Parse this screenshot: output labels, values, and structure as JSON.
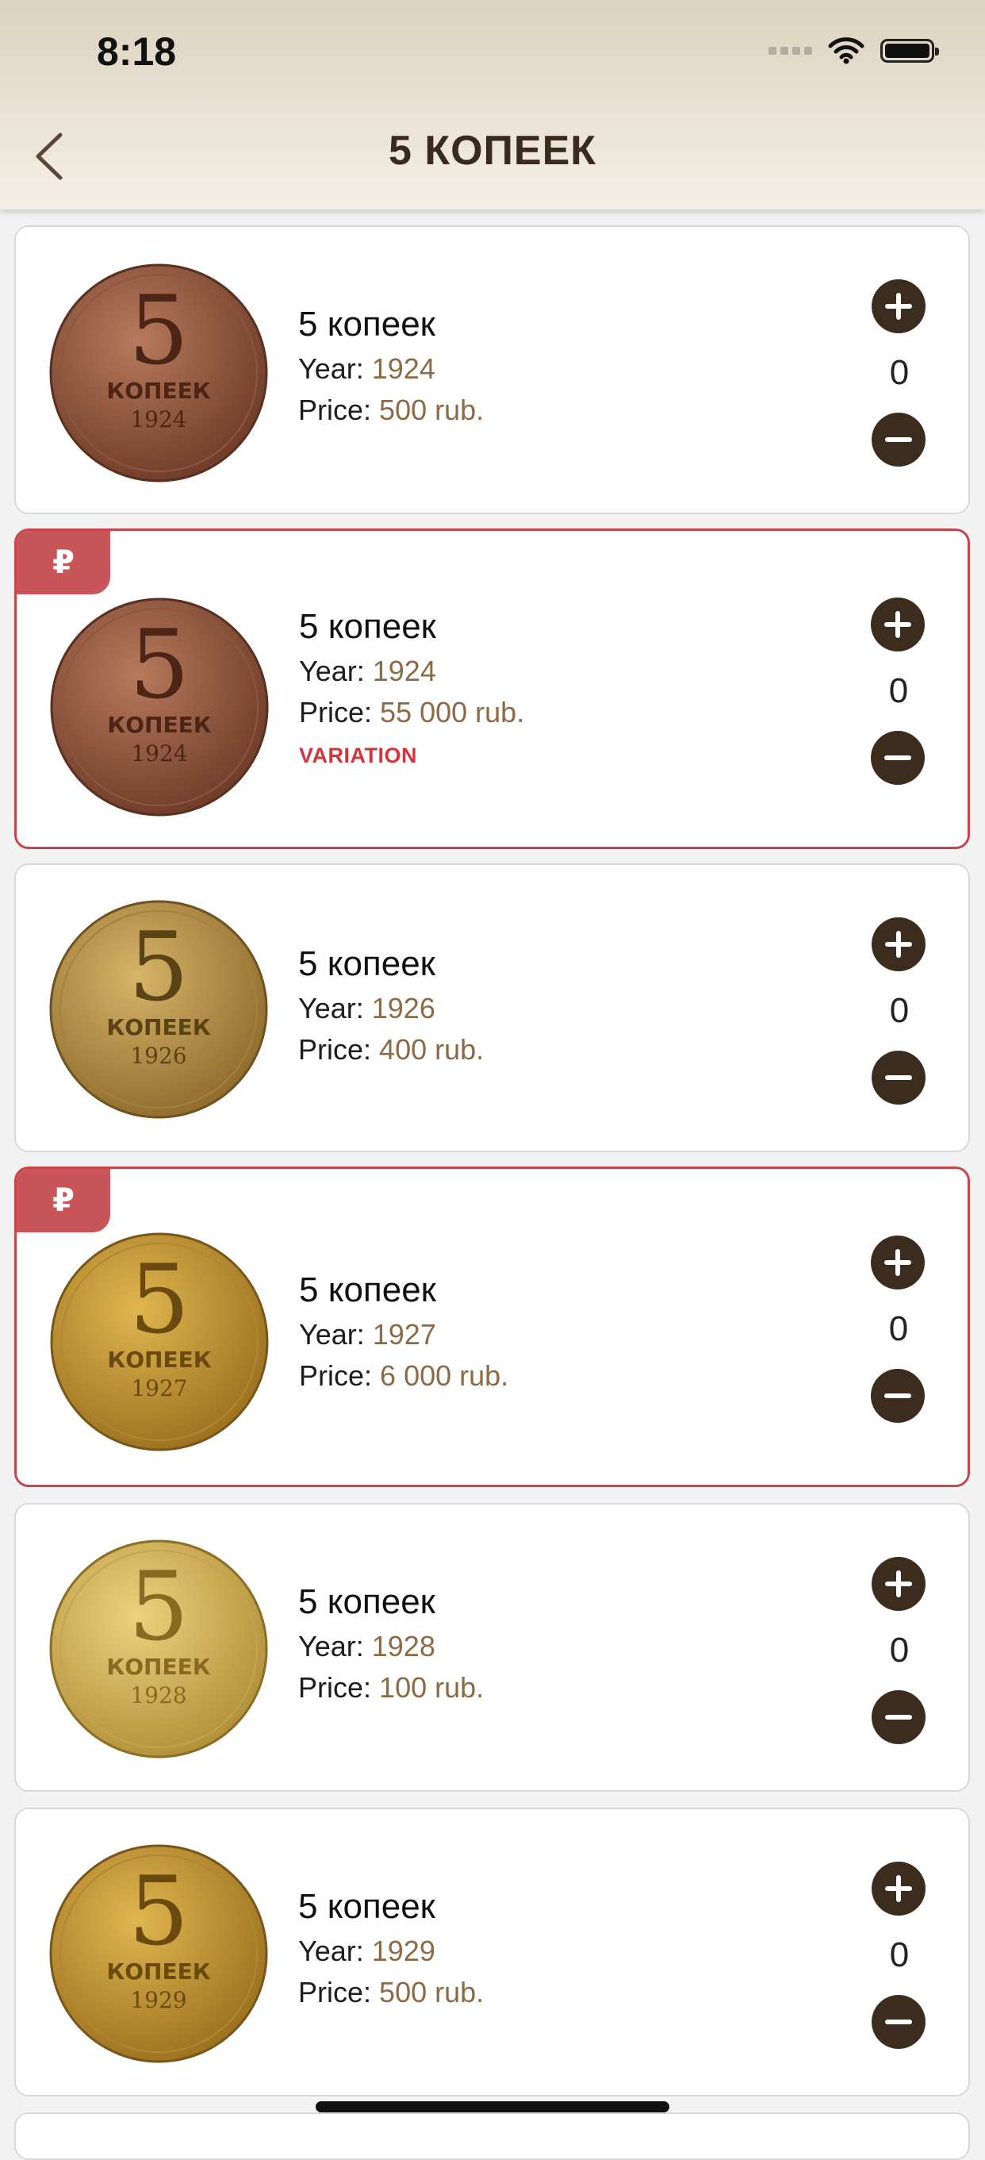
{
  "status_bar": {
    "time": "8:18"
  },
  "nav": {
    "title": "5 КОПЕЕК"
  },
  "labels": {
    "year": "Year:",
    "price": "Price:"
  },
  "colors": {
    "accent_brown": "#3b2c1e",
    "price_color": "#8c6a45",
    "flag_red": "#c8555a",
    "variation_red": "#d3343a"
  },
  "items": [
    {
      "name": "5 копеек",
      "year": "1924",
      "price": "500 rub.",
      "count": "0",
      "coin_year": "1924",
      "badge": "",
      "variation": ""
    },
    {
      "name": "5 копеек",
      "year": "1924",
      "price": "55 000 rub.",
      "count": "0",
      "coin_year": "1924",
      "badge": "₽",
      "variation": "VARIATION"
    },
    {
      "name": "5 копеек",
      "year": "1926",
      "price": "400 rub.",
      "count": "0",
      "coin_year": "1926",
      "badge": "",
      "variation": ""
    },
    {
      "name": "5 копеек",
      "year": "1927",
      "price": "6 000 rub.",
      "count": "0",
      "coin_year": "1927",
      "badge": "₽",
      "variation": ""
    },
    {
      "name": "5 копеек",
      "year": "1928",
      "price": "100 rub.",
      "count": "0",
      "coin_year": "1928",
      "badge": "",
      "variation": ""
    },
    {
      "name": "5 копеек",
      "year": "1929",
      "price": "500 rub.",
      "count": "0",
      "coin_year": "1929",
      "badge": "",
      "variation": ""
    }
  ]
}
